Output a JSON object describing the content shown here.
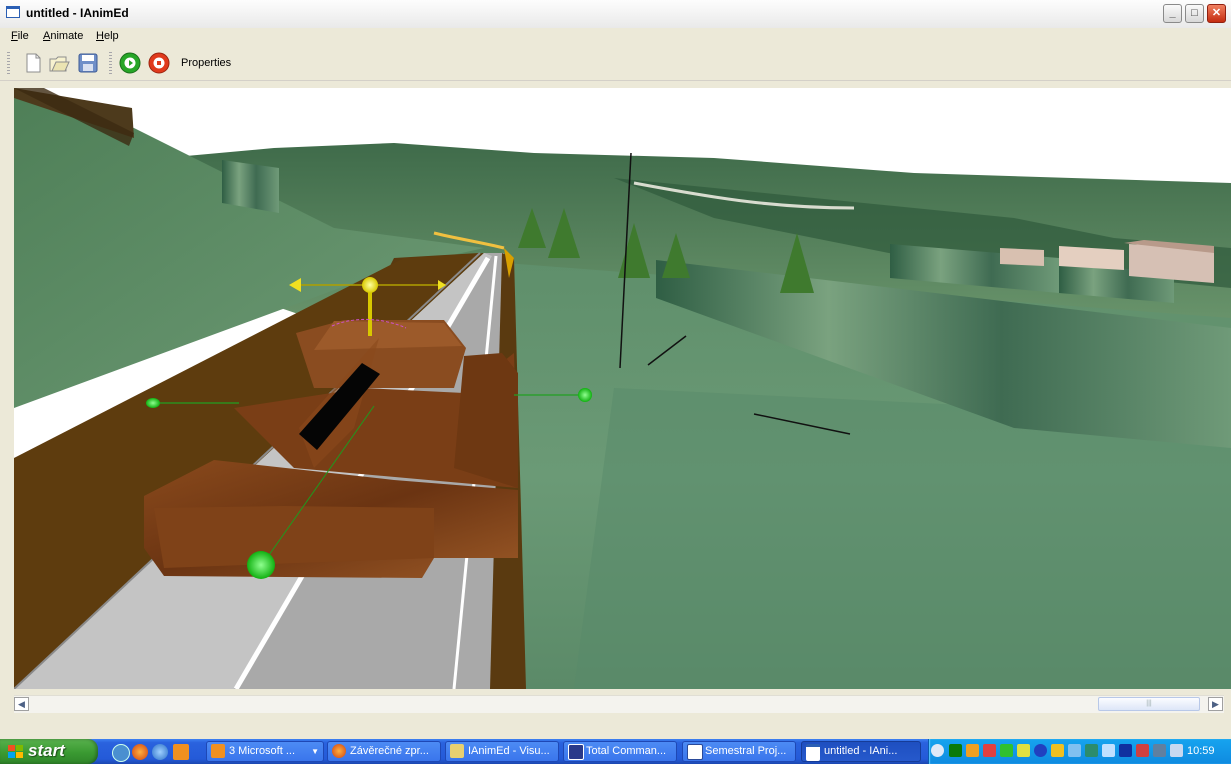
{
  "window": {
    "title": "untitled - IAnimEd"
  },
  "menu": {
    "items": [
      "File",
      "Animate",
      "Help"
    ]
  },
  "toolbar": {
    "buttons": [
      "new-icon",
      "open-icon",
      "save-icon",
      "play-icon",
      "stop-icon"
    ],
    "properties_label": "Properties"
  },
  "taskbar": {
    "start_label": "start",
    "tasks": [
      {
        "label": "3 Microsoft ...",
        "icon": "office-icon"
      },
      {
        "label": "Závěrečné zpr...",
        "icon": "firefox-icon"
      },
      {
        "label": "IAnimEd - Visu...",
        "icon": "visual-studio-icon"
      },
      {
        "label": "Total Comman...",
        "icon": "floppy-icon"
      },
      {
        "label": "Semestral Proj...",
        "icon": "word-icon"
      },
      {
        "label": "untitled - IAni...",
        "icon": "window-icon"
      }
    ],
    "clock": "10:59"
  },
  "colors": {
    "taskbar_blue": "#245ad8",
    "start_green": "#3a9a32",
    "tray_blue": "#0f8be0",
    "gizmo_green": "#22d022",
    "gizmo_yellow": "#f0e020",
    "tank_brown": "#7a3e14"
  }
}
